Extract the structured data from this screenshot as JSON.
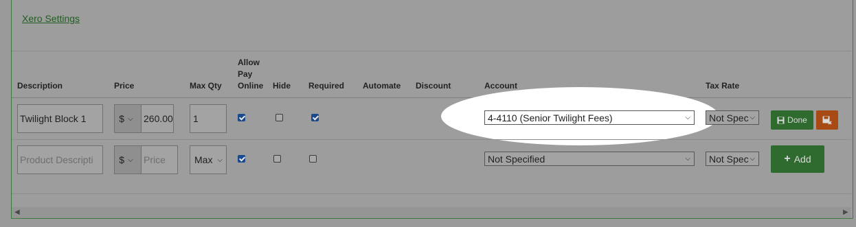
{
  "settings": {
    "xero_link": "Xero Settings"
  },
  "table": {
    "headers": {
      "description": "Description",
      "price": "Price",
      "max_qty": "Max Qty",
      "allow_pay_online": [
        "Allow",
        "Pay",
        "Online"
      ],
      "hide": "Hide",
      "required": "Required",
      "automate": "Automate",
      "discount": "Discount",
      "account": "Account",
      "tax_rate": "Tax Rate"
    },
    "row1": {
      "description": "Twilight Block 1",
      "currency": "$",
      "price": "260.00",
      "max_qty": "1",
      "allow_pay_online": true,
      "hide": false,
      "required": true,
      "account": "4-4110 (Senior Twilight Fees)",
      "tax_rate": "Not Spec",
      "done_label": "Done"
    },
    "row2": {
      "description_placeholder": "Product Descripti",
      "currency": "$",
      "price_placeholder": "Price",
      "max_qty": "Max",
      "allow_pay_online": true,
      "hide": false,
      "required": false,
      "account": "Not Specified",
      "tax_rate": "Not Spec",
      "add_label": "Add"
    }
  },
  "colors": {
    "done": "#2f6b2f",
    "delete": "#a84a14",
    "add": "#2f6b2f",
    "highlight": "#ffffff"
  },
  "icons": {
    "done": "save-icon",
    "delete": "save-remove-icon",
    "add": "plus-icon"
  }
}
